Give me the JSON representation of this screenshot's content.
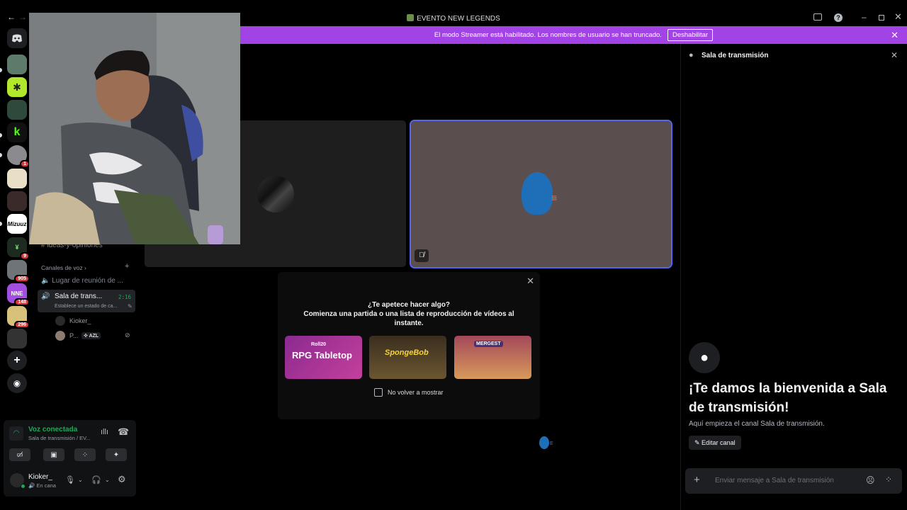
{
  "window": {
    "title": "EVENTO NEW LEGENDS"
  },
  "banner": {
    "text": "El modo Streamer está habilitado. Los nombres de usuario se han truncado.",
    "button": "Deshabilitar"
  },
  "guild_badges": {
    "g6": "1",
    "g9": "9",
    "g10": "905",
    "g11": "148",
    "g12": "296"
  },
  "guild_labels": {
    "g8": "Mizuuz",
    "g11": "NNE"
  },
  "channels": {
    "text_channel": "ideas-y-opiniones",
    "voice_category": "Canales de voz",
    "voice1": "Lugar de reunión de ...",
    "voice2": "Sala de trans...",
    "voice2_time": "2:16",
    "voice2_status": "Establece un estado de ca...",
    "member1": "Kioker_",
    "member2": "P...",
    "member2_tag": "AZL"
  },
  "voice_panel": {
    "status": "Voz conectada",
    "channel": "Sala de transmisión / EV..."
  },
  "user_panel": {
    "name": "Kioker_",
    "status": "En cana"
  },
  "activity": {
    "line1": "¿Te apetece hacer algo?",
    "line2": "Comienza una partida o una lista de reproducción de vídeos al instante.",
    "checkbox": "No volver a mostrar",
    "card1_small": "Roll20",
    "card1": "RPG Tabletop",
    "card2": "SpongeBob",
    "card3": "MERGEST"
  },
  "chat": {
    "header": "Sala de transmisión",
    "welcome": "¡Te damos la bienvenida a Sala de transmisión!",
    "sub": "Aquí empieza el canal Sala de transmisión.",
    "edit": "Editar canal",
    "placeholder": "Enviar mensaje a Sala de transmisión"
  },
  "floating_label": "E",
  "colors": {
    "accent": "#5865f2",
    "banner": "#a243e6",
    "connected": "#23a55a"
  }
}
